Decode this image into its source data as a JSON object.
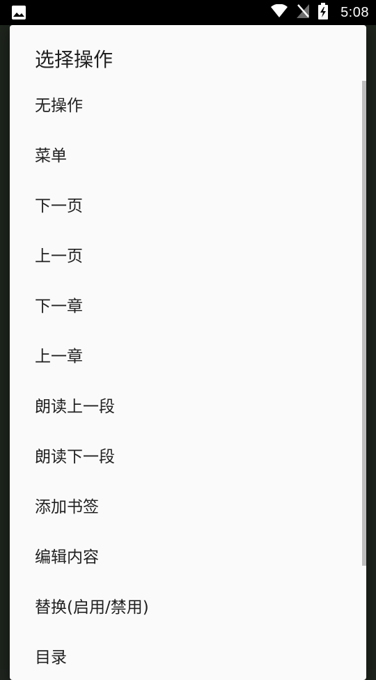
{
  "status_bar": {
    "time": "5:08",
    "icons": [
      "image-icon",
      "wifi-icon",
      "no-sim-icon",
      "battery-charging-icon"
    ]
  },
  "dialog": {
    "title": "选择操作",
    "items": [
      {
        "label": "无操作"
      },
      {
        "label": "菜单"
      },
      {
        "label": "下一页"
      },
      {
        "label": "上一页"
      },
      {
        "label": "下一章"
      },
      {
        "label": "上一章"
      },
      {
        "label": "朗读上一段"
      },
      {
        "label": "朗读下一段"
      },
      {
        "label": "添加书签"
      },
      {
        "label": "编辑内容"
      },
      {
        "label": "替换(启用/禁用)"
      },
      {
        "label": "目录"
      }
    ]
  },
  "colors": {
    "dialog_bg": "#fafafa",
    "text": "#212121",
    "scrollbar": "#bdbdbd",
    "status_bar_bg": "#000000"
  }
}
